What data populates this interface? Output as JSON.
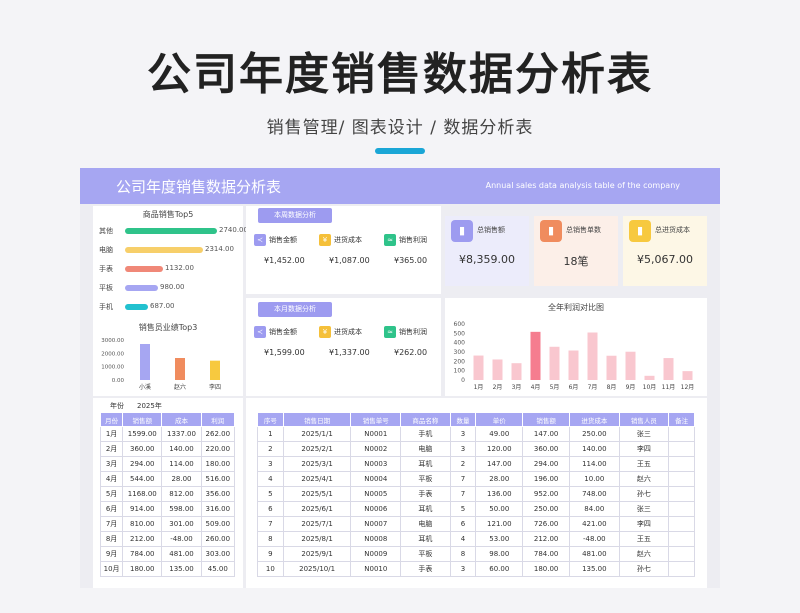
{
  "page": {
    "title": "公司年度销售数据分析表",
    "subtitle": "销售管理/  图表设计  / 数据分析表"
  },
  "banner": {
    "title": "公司年度销售数据分析表",
    "subtitle_en": "Annual sales data analysis table of the company"
  },
  "top5": {
    "title": "商品销售Top5",
    "items": [
      {
        "label": "其他",
        "value": 2740.0,
        "value_text": "2740.00",
        "color": "#2fc38a"
      },
      {
        "label": "电脑",
        "value": 2314.0,
        "value_text": "2314.00",
        "color": "#f7cf6a"
      },
      {
        "label": "手表",
        "value": 1132.0,
        "value_text": "1132.00",
        "color": "#f08878"
      },
      {
        "label": "平板",
        "value": 980.0,
        "value_text": "980.00",
        "color": "#a6a6f2"
      },
      {
        "label": "手机",
        "value": 687.0,
        "value_text": "687.00",
        "color": "#22c1cf"
      }
    ]
  },
  "staff_top3": {
    "title": "销售员业绩Top3",
    "yticks": [
      "3000.00",
      "2000.00",
      "1000.00",
      "0.00"
    ],
    "ymax": 3000,
    "items": [
      {
        "name": "小溪",
        "value": 2700,
        "color": "#a6a6f2"
      },
      {
        "name": "赵六",
        "value": 1650,
        "color": "#f08c5e"
      },
      {
        "name": "李四",
        "value": 1450,
        "color": "#f7c93f"
      }
    ]
  },
  "week": {
    "tag": "本周数据分析",
    "metrics": [
      {
        "icon": "share-icon",
        "glyph": "≺",
        "color": "#9d9bf0",
        "label": "销售金额",
        "value": "¥1,452.00"
      },
      {
        "icon": "cost-icon",
        "glyph": "¥",
        "color": "#f5c03a",
        "label": "进货成本",
        "value": "¥1,087.00"
      },
      {
        "icon": "profit-icon",
        "glyph": "≈",
        "color": "#2fc38a",
        "label": "销售利润",
        "value": "¥365.00"
      }
    ]
  },
  "month": {
    "tag": "本月数据分析",
    "metrics": [
      {
        "icon": "share-icon",
        "glyph": "≺",
        "color": "#9d9bf0",
        "label": "销售金额",
        "value": "¥1,599.00"
      },
      {
        "icon": "cost-icon",
        "glyph": "¥",
        "color": "#f5c03a",
        "label": "进货成本",
        "value": "¥1,337.00"
      },
      {
        "icon": "profit-icon",
        "glyph": "≈",
        "color": "#2fc38a",
        "label": "销售利润",
        "value": "¥262.00"
      }
    ]
  },
  "kpis": [
    {
      "icon": "chart-icon",
      "color": "#9d9bf0",
      "bg": "#ececfb",
      "label": "总销售额",
      "value": "¥8,359.00"
    },
    {
      "icon": "chart-icon",
      "color": "#f08c5e",
      "bg": "#fcefe8",
      "label": "总销售单数",
      "value": "18笔"
    },
    {
      "icon": "chart-icon",
      "color": "#f7c93f",
      "bg": "#fdf7e6",
      "label": "总进货成本",
      "value": "¥5,067.00"
    }
  ],
  "chart_data": {
    "type": "bar",
    "title": "全年利润对比图",
    "categories": [
      "1月",
      "2月",
      "3月",
      "4月",
      "5月",
      "6月",
      "7月",
      "8月",
      "9月",
      "10月",
      "11月",
      "12月"
    ],
    "values": [
      262,
      220,
      180,
      516,
      356,
      316,
      509,
      260,
      303,
      45,
      235,
      95
    ],
    "highlight_index": 3,
    "yticks": [
      600,
      500,
      400,
      300,
      200,
      100,
      0
    ],
    "ylim": [
      0,
      600
    ],
    "colors": {
      "bar": "#f9c7cf",
      "highlight": "#f57d8f"
    }
  },
  "year_row": {
    "label": "年份",
    "value": "2025年"
  },
  "monthly": {
    "headers": [
      "月份",
      "销售额",
      "成本",
      "利润"
    ],
    "rows": [
      [
        "1月",
        "1599.00",
        "1337.00",
        "262.00"
      ],
      [
        "2月",
        "360.00",
        "140.00",
        "220.00"
      ],
      [
        "3月",
        "294.00",
        "114.00",
        "180.00"
      ],
      [
        "4月",
        "544.00",
        "28.00",
        "516.00"
      ],
      [
        "5月",
        "1168.00",
        "812.00",
        "356.00"
      ],
      [
        "6月",
        "914.00",
        "598.00",
        "316.00"
      ],
      [
        "7月",
        "810.00",
        "301.00",
        "509.00"
      ],
      [
        "8月",
        "212.00",
        "-48.00",
        "260.00"
      ],
      [
        "9月",
        "784.00",
        "481.00",
        "303.00"
      ],
      [
        "10月",
        "180.00",
        "135.00",
        "45.00"
      ]
    ]
  },
  "orders": {
    "headers": [
      "序号",
      "销售日期",
      "销售单号",
      "商品名称",
      "数量",
      "单价",
      "销售额",
      "进货成本",
      "销售人员",
      "备注"
    ],
    "rows": [
      [
        "1",
        "2025/1/1",
        "N0001",
        "手机",
        "3",
        "49.00",
        "147.00",
        "250.00",
        "张三",
        ""
      ],
      [
        "2",
        "2025/2/1",
        "N0002",
        "电脑",
        "3",
        "120.00",
        "360.00",
        "140.00",
        "李四",
        ""
      ],
      [
        "3",
        "2025/3/1",
        "N0003",
        "耳机",
        "2",
        "147.00",
        "294.00",
        "114.00",
        "王五",
        ""
      ],
      [
        "4",
        "2025/4/1",
        "N0004",
        "平板",
        "7",
        "28.00",
        "196.00",
        "10.00",
        "赵六",
        ""
      ],
      [
        "5",
        "2025/5/1",
        "N0005",
        "手表",
        "7",
        "136.00",
        "952.00",
        "748.00",
        "孙七",
        ""
      ],
      [
        "6",
        "2025/6/1",
        "N0006",
        "耳机",
        "5",
        "50.00",
        "250.00",
        "84.00",
        "张三",
        ""
      ],
      [
        "7",
        "2025/7/1",
        "N0007",
        "电脑",
        "6",
        "121.00",
        "726.00",
        "421.00",
        "李四",
        ""
      ],
      [
        "8",
        "2025/8/1",
        "N0008",
        "耳机",
        "4",
        "53.00",
        "212.00",
        "-48.00",
        "王五",
        ""
      ],
      [
        "9",
        "2025/9/1",
        "N0009",
        "平板",
        "8",
        "98.00",
        "784.00",
        "481.00",
        "赵六",
        ""
      ],
      [
        "10",
        "2025/10/1",
        "N0010",
        "手表",
        "3",
        "60.00",
        "180.00",
        "135.00",
        "孙七",
        ""
      ]
    ]
  }
}
